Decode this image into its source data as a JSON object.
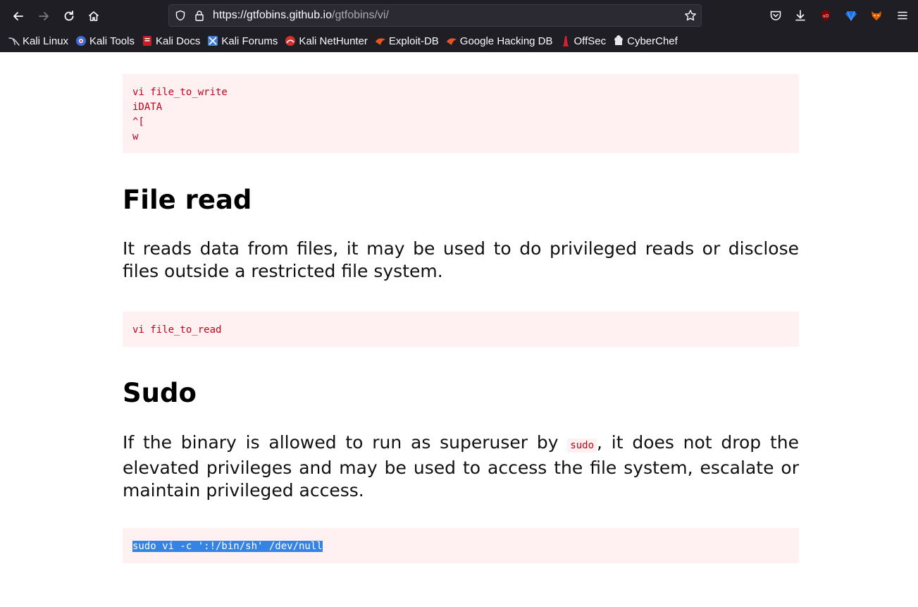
{
  "browser": {
    "url_host": "https://gtfobins.github.io",
    "url_path": "/gtfobins/vi/",
    "bookmarks": [
      {
        "label": "Kali Linux",
        "icon": "kali-dragon-icon"
      },
      {
        "label": "Kali Tools",
        "icon": "kali-tools-icon"
      },
      {
        "label": "Kali Docs",
        "icon": "kali-docs-icon"
      },
      {
        "label": "Kali Forums",
        "icon": "kali-forums-icon"
      },
      {
        "label": "Kali NetHunter",
        "icon": "kali-nethunter-icon"
      },
      {
        "label": "Exploit-DB",
        "icon": "exploit-db-icon"
      },
      {
        "label": "Google Hacking DB",
        "icon": "ghdb-icon"
      },
      {
        "label": "OffSec",
        "icon": "offsec-icon"
      },
      {
        "label": "CyberChef",
        "icon": "cyberchef-icon"
      }
    ]
  },
  "page": {
    "write_code": "vi file_to_write\niDATA\n^[\nw",
    "file_read": {
      "heading": "File read",
      "description": "It reads data from files, it may be used to do privileged reads or disclose files outside a restricted file system.",
      "code": "vi file_to_read"
    },
    "sudo": {
      "heading": "Sudo",
      "description_before": "If the binary is allowed to run as superuser by ",
      "inline_code": "sudo",
      "description_after": ", it does not drop the elevated privileges and may be used to access the file system, escalate or maintain privileged access.",
      "code": "sudo vi -c ':!/bin/sh' /dev/null"
    }
  },
  "colors": {
    "code_text": "#c7001b",
    "code_bg": "#fff1f1",
    "selection": "#3584e4",
    "chrome_bg": "#1f1e25"
  }
}
